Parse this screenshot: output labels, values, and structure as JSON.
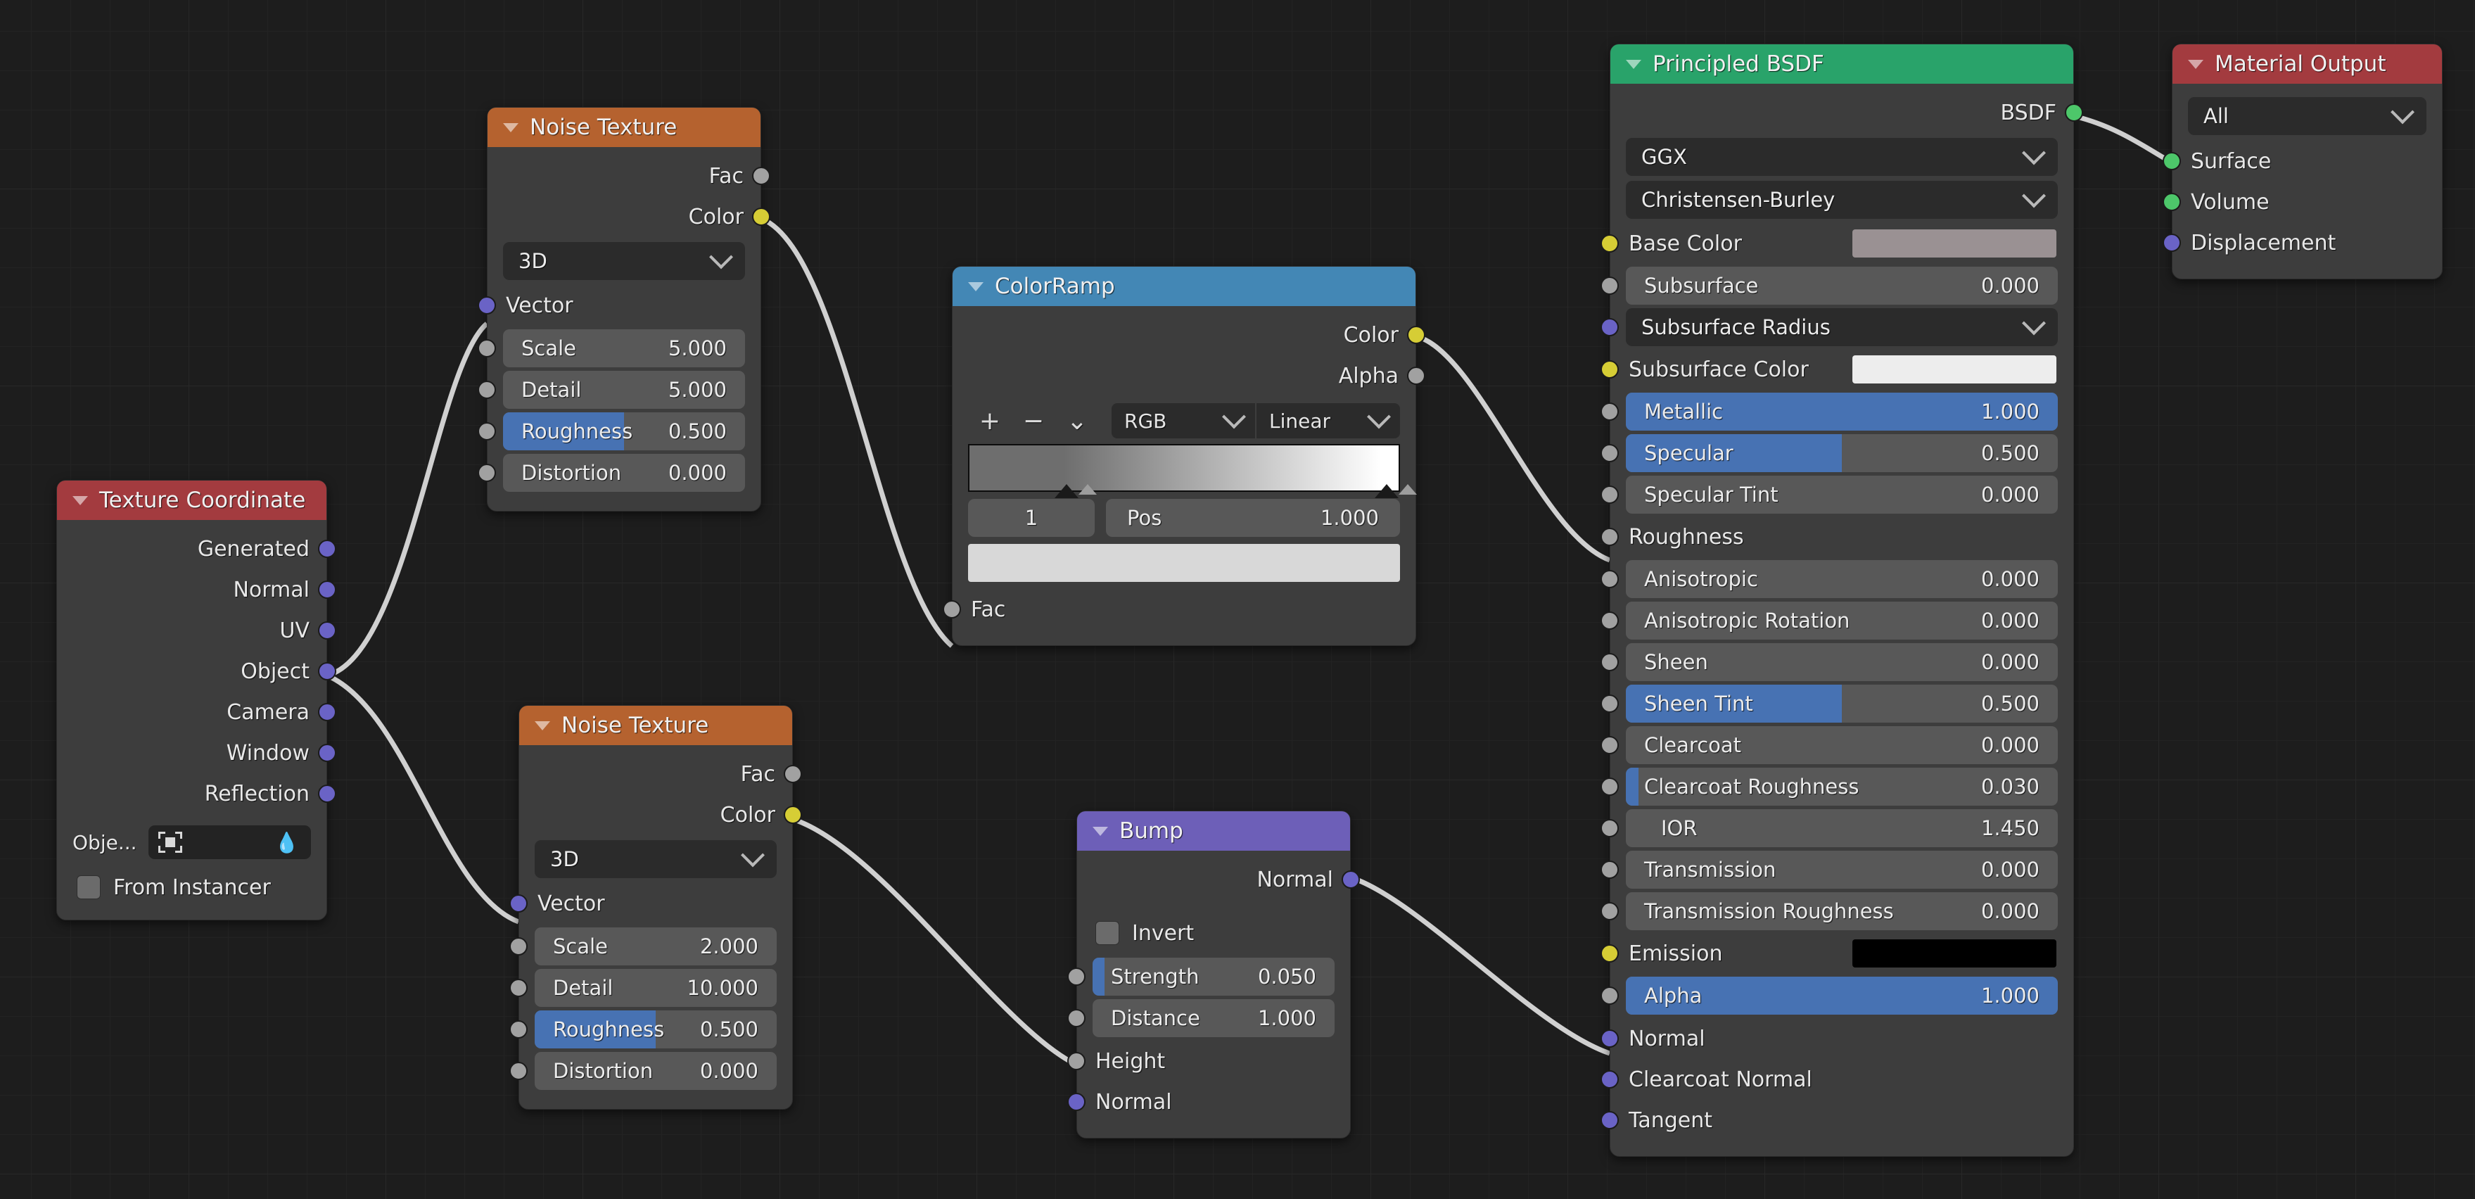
{
  "editor": {
    "background_color": "#1d1d1d",
    "grid_color": "#282828",
    "wire_color": "#d8d8d8"
  },
  "socket_colors": {
    "gray": "#a1a1a1",
    "yellow": "#d6cd35",
    "purple": "#6a63c6",
    "green": "#4dc76a"
  },
  "nodes": {
    "texture_coordinate": {
      "title": "Texture Coordinate",
      "header_color": "#a33b3f",
      "outputs": [
        "Generated",
        "Normal",
        "UV",
        "Object",
        "Camera",
        "Window",
        "Reflection"
      ],
      "object_label": "Obje...",
      "object_value": "",
      "from_instancer_label": "From Instancer",
      "from_instancer_checked": false
    },
    "noise_texture_1": {
      "title": "Noise Texture",
      "header_color": "#b5622f",
      "outputs": [
        "Fac",
        "Color"
      ],
      "dimension": "3D",
      "vector_label": "Vector",
      "properties": [
        {
          "label": "Scale",
          "value": "5.000",
          "fill": 0
        },
        {
          "label": "Detail",
          "value": "5.000",
          "fill": 0
        },
        {
          "label": "Roughness",
          "value": "0.500",
          "fill": 50
        },
        {
          "label": "Distortion",
          "value": "0.000",
          "fill": 0
        }
      ]
    },
    "noise_texture_2": {
      "title": "Noise Texture",
      "header_color": "#b5622f",
      "outputs": [
        "Fac",
        "Color"
      ],
      "dimension": "3D",
      "vector_label": "Vector",
      "properties": [
        {
          "label": "Scale",
          "value": "2.000",
          "fill": 0
        },
        {
          "label": "Detail",
          "value": "10.000",
          "fill": 0
        },
        {
          "label": "Roughness",
          "value": "0.500",
          "fill": 50
        },
        {
          "label": "Distortion",
          "value": "0.000",
          "fill": 0
        }
      ]
    },
    "color_ramp": {
      "title": "ColorRamp",
      "header_color": "#4387b5",
      "outputs": [
        "Color",
        "Alpha"
      ],
      "tools": {
        "add": "+",
        "remove": "−",
        "menu": "⌄"
      },
      "color_mode": "RGB",
      "interpolation": "Linear",
      "index_value": "1",
      "pos_label": "Pos",
      "pos_value": "1.000",
      "stops": [
        {
          "pos": 0.226,
          "color": "#6e6e6e",
          "selected": false
        },
        {
          "pos": 1.0,
          "color": "#f0f0f0",
          "selected": true
        }
      ],
      "gradient_from": "#6e6e6e",
      "gradient_to": "#ffffff",
      "selected_color": "#d8d8d8",
      "input_label": "Fac"
    },
    "bump": {
      "title": "Bump",
      "header_color": "#6d5fb8",
      "outputs": [
        "Normal"
      ],
      "invert_label": "Invert",
      "invert_checked": false,
      "properties": [
        {
          "label": "Strength",
          "value": "0.050",
          "fill": 5
        },
        {
          "label": "Distance",
          "value": "1.000",
          "fill": 0
        }
      ],
      "inputs": [
        "Height",
        "Normal"
      ]
    },
    "principled_bsdf": {
      "title": "Principled BSDF",
      "header_color": "#29a36a",
      "outputs": [
        "BSDF"
      ],
      "distribution": "GGX",
      "subsurface_method": "Christensen-Burley",
      "base_color_label": "Base Color",
      "base_color_value": "#9a9193",
      "subsurface_radius_label": "Subsurface Radius",
      "subsurface_color_label": "Subsurface Color",
      "subsurface_color_value": "#ededed",
      "emission_label": "Emission",
      "emission_color_value": "#000000",
      "rows": [
        {
          "label": "Subsurface",
          "value": "0.000",
          "fill": 0,
          "socket": "gray"
        },
        {
          "label": "Metallic",
          "value": "1.000",
          "fill": 100,
          "socket": "gray"
        },
        {
          "label": "Specular",
          "value": "0.500",
          "fill": 50,
          "socket": "gray"
        },
        {
          "label": "Specular Tint",
          "value": "0.000",
          "fill": 0,
          "socket": "gray"
        },
        {
          "label": "Roughness",
          "value": "",
          "fill": 0,
          "socket": "gray",
          "connected": true
        },
        {
          "label": "Anisotropic",
          "value": "0.000",
          "fill": 0,
          "socket": "gray"
        },
        {
          "label": "Anisotropic Rotation",
          "value": "0.000",
          "fill": 0,
          "socket": "gray"
        },
        {
          "label": "Sheen",
          "value": "0.000",
          "fill": 0,
          "socket": "gray"
        },
        {
          "label": "Sheen Tint",
          "value": "0.500",
          "fill": 50,
          "socket": "gray"
        },
        {
          "label": "Clearcoat",
          "value": "0.000",
          "fill": 0,
          "socket": "gray"
        },
        {
          "label": "Clearcoat Roughness",
          "value": "0.030",
          "fill": 3,
          "socket": "gray"
        },
        {
          "label": "IOR",
          "value": "1.450",
          "fill": 0,
          "socket": "gray"
        },
        {
          "label": "Transmission",
          "value": "0.000",
          "fill": 0,
          "socket": "gray"
        },
        {
          "label": "Transmission Roughness",
          "value": "0.000",
          "fill": 0,
          "socket": "gray"
        },
        {
          "label": "Alpha",
          "value": "1.000",
          "fill": 100,
          "socket": "gray"
        }
      ],
      "normal_inputs": [
        "Normal",
        "Clearcoat Normal",
        "Tangent"
      ]
    },
    "material_output": {
      "title": "Material Output",
      "header_color": "#a33b3f",
      "target": "All",
      "inputs": [
        {
          "label": "Surface",
          "socket": "green"
        },
        {
          "label": "Volume",
          "socket": "green"
        },
        {
          "label": "Displacement",
          "socket": "purple"
        }
      ]
    }
  }
}
